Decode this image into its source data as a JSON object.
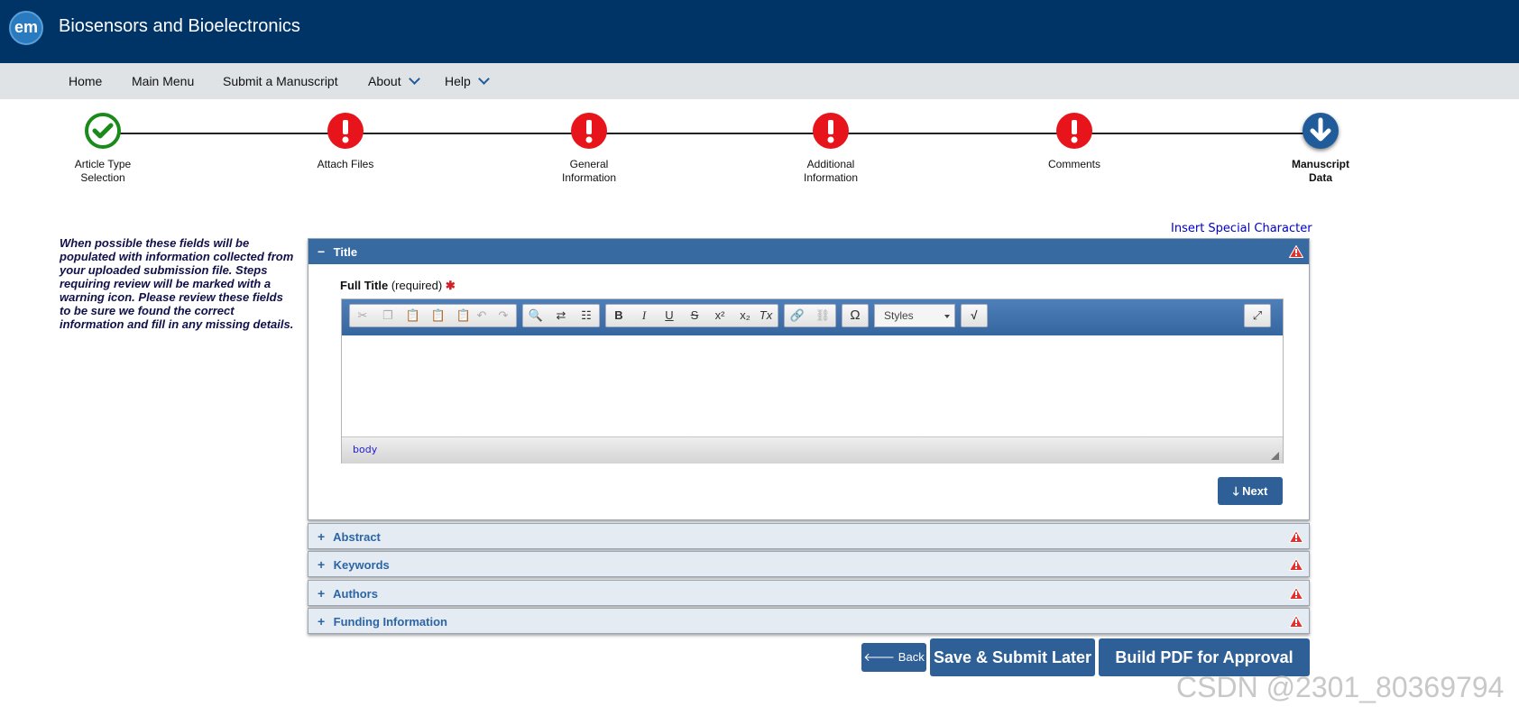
{
  "header": {
    "logo_text": "em",
    "journal_title": "Biosensors and Bioelectronics",
    "colors": {
      "topbar": "#003366",
      "navbar": "#e0e3e6",
      "accent": "#2e5f96"
    }
  },
  "nav": {
    "items": [
      {
        "label": "Home"
      },
      {
        "label": "Main Menu"
      },
      {
        "label": "Submit a Manuscript"
      },
      {
        "label": "About",
        "has_dropdown": true
      },
      {
        "label": "Help",
        "has_dropdown": true
      }
    ]
  },
  "wizard": {
    "steps": [
      {
        "label_line1": "Article Type",
        "label_line2": "Selection",
        "status": "complete",
        "icon": "check-icon"
      },
      {
        "label_line1": "Attach Files",
        "label_line2": "",
        "status": "warning",
        "icon": "exclamation-icon"
      },
      {
        "label_line1": "General",
        "label_line2": "Information",
        "status": "warning",
        "icon": "exclamation-icon"
      },
      {
        "label_line1": "Additional",
        "label_line2": "Information",
        "status": "warning",
        "icon": "exclamation-icon"
      },
      {
        "label_line1": "Comments",
        "label_line2": "",
        "status": "warning",
        "icon": "exclamation-icon"
      },
      {
        "label_line1": "Manuscript",
        "label_line2": "Data",
        "status": "current",
        "icon": "arrow-down-icon"
      }
    ]
  },
  "side_note": "When possible these fields will be populated with information collected from your uploaded submission file. Steps requiring review will be marked with a warning icon. Please review these fields to be sure we found the correct information and fill in any missing details.",
  "insert_special_character": "Insert Special Character",
  "sections": {
    "title": {
      "heading": "Title",
      "expanded": true,
      "field_label": "Full Title",
      "field_hint": "(required)",
      "required_mark": "✱",
      "editor": {
        "styles_label": "Styles",
        "status_path": "body",
        "content": ""
      },
      "next_label": "Next"
    },
    "collapsed": [
      {
        "heading": "Abstract"
      },
      {
        "heading": "Keywords"
      },
      {
        "heading": "Authors"
      },
      {
        "heading": "Funding Information"
      }
    ]
  },
  "buttons": {
    "back": "Back",
    "save_later": "Save & Submit Later",
    "build_pdf": "Build PDF for Approval"
  },
  "watermark": "CSDN @2301_80369794"
}
